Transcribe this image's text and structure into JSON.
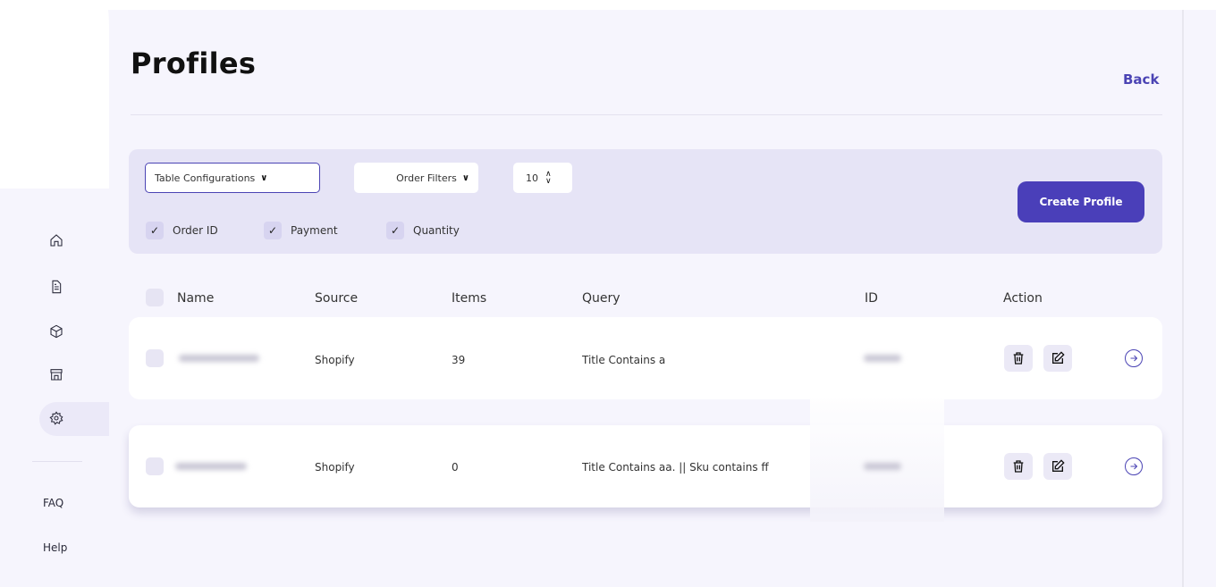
{
  "page": {
    "title": "Profiles",
    "back_label": "Back"
  },
  "sidebar": {
    "icons": [
      "home-icon",
      "document-icon",
      "box-icon",
      "store-icon",
      "settings-icon"
    ],
    "links": [
      "FAQ",
      "Help"
    ]
  },
  "filters": {
    "table_config_label": "Table Configurations",
    "order_filters_label": "Order Filters",
    "page_size": "10",
    "checkboxes": [
      "Order ID",
      "Payment",
      "Quantity"
    ],
    "create_button": "Create Profile"
  },
  "table": {
    "headers": [
      "Name",
      "Source",
      "Items",
      "Query",
      "ID",
      "Action"
    ],
    "rows": [
      {
        "name": "",
        "source": "Shopify",
        "items": "39",
        "query": "Title Contains a",
        "id": ""
      },
      {
        "name": "",
        "source": "Shopify",
        "items": "0",
        "query": "Title Contains aa. || Sku contains ff",
        "id": ""
      }
    ]
  },
  "colors": {
    "accent": "#4a3fb9",
    "panel": "#e6e4f6",
    "background": "#f6f5fd"
  }
}
